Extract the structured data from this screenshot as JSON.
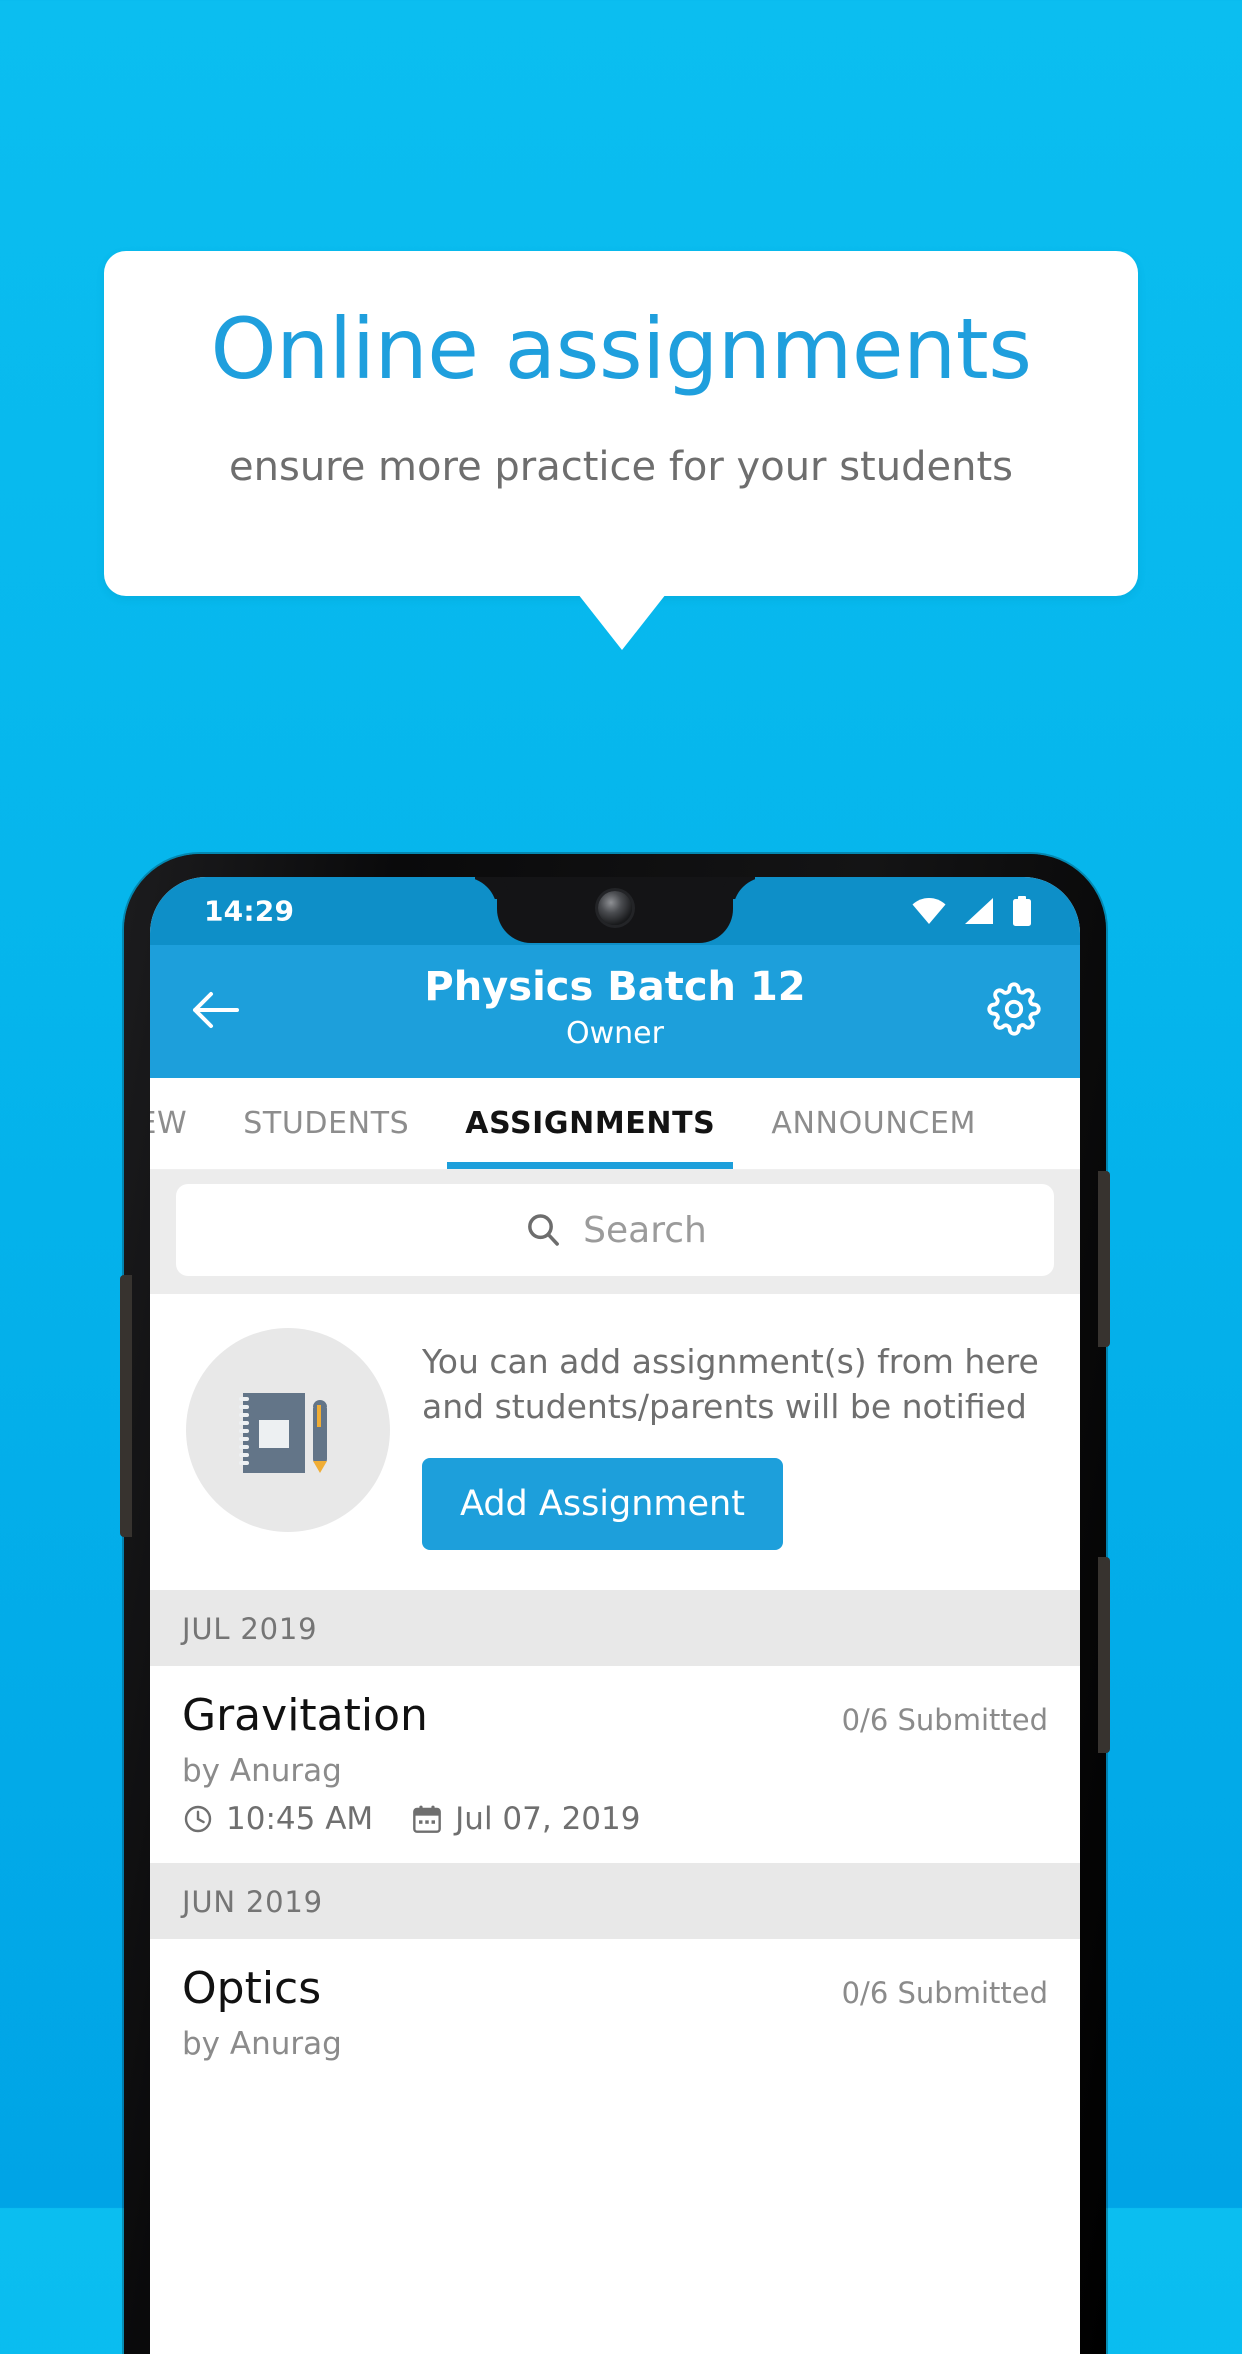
{
  "promo": {
    "title": "Online assignments",
    "subtitle": "ensure more practice for your students",
    "title_color": "#1f9fdd",
    "background_color": "#06bcee"
  },
  "phone": {
    "status_bar": {
      "time": "14:29",
      "icons": [
        "wifi-icon",
        "signal-icon",
        "battery-icon"
      ]
    },
    "app_bar": {
      "back_icon": "back-arrow-icon",
      "title": "Physics Batch 12",
      "subtitle": "Owner",
      "settings_icon": "gear-icon",
      "color": "#1d9fdb"
    },
    "tabs": [
      {
        "label": "IEW",
        "active": false
      },
      {
        "label": "STUDENTS",
        "active": false
      },
      {
        "label": "ASSIGNMENTS",
        "active": true
      },
      {
        "label": "ANNOUNCEM",
        "active": false
      }
    ],
    "search": {
      "icon": "search-icon",
      "placeholder": "Search",
      "value": ""
    },
    "empty_state": {
      "illustration": "notebook-and-pen-icon",
      "text": "You can add assignment(s) from here and students/parents will be notified",
      "button_label": "Add Assignment",
      "button_color": "#1d9fdb"
    },
    "sections": [
      {
        "month": "JUL 2019",
        "rows": [
          {
            "title": "Gravitation",
            "submitted": "0/6 Submitted",
            "author": "by Anurag",
            "time_icon": "clock-icon",
            "time": "10:45 AM",
            "date_icon": "calendar-icon",
            "date": "Jul 07, 2019"
          }
        ]
      },
      {
        "month": "JUN 2019",
        "rows": [
          {
            "title": "Optics",
            "submitted": "0/6 Submitted",
            "author": "by Anurag",
            "time_icon": "clock-icon",
            "time": "",
            "date_icon": "calendar-icon",
            "date": ""
          }
        ]
      }
    ]
  }
}
